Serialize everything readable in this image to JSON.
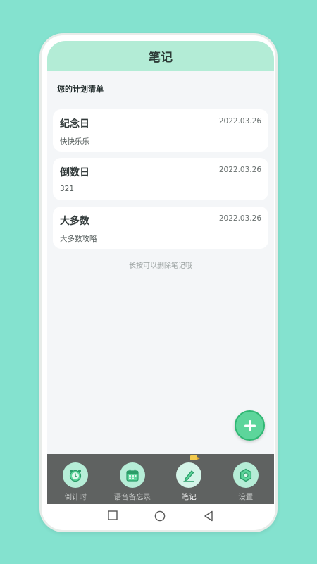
{
  "header": {
    "title": "笔记"
  },
  "section": {
    "title": "您的计划清单"
  },
  "notes": [
    {
      "title": "纪念日",
      "date": "2022.03.26",
      "content": "快快乐乐"
    },
    {
      "title": "倒数日",
      "date": "2022.03.26",
      "content": "321"
    },
    {
      "title": "大多数",
      "date": "2022.03.26",
      "content": "大多数攻略"
    }
  ],
  "hint": "长按可以删除笔记哦",
  "fab": {
    "icon": "plus-icon"
  },
  "tabs": [
    {
      "label": "倒计时",
      "icon": "alarm-clock-icon",
      "active": false
    },
    {
      "label": "语音备忘录",
      "icon": "calendar-icon",
      "active": false
    },
    {
      "label": "笔记",
      "icon": "pen-icon",
      "active": true
    },
    {
      "label": "设置",
      "icon": "gear-icon",
      "active": false
    }
  ],
  "colors": {
    "background": "#84e2cf",
    "header": "#b3ecd6",
    "accent": "#5dd59b",
    "tabbar": "#5f6261"
  },
  "system_nav": [
    "square-icon",
    "circle-icon",
    "triangle-back-icon"
  ]
}
